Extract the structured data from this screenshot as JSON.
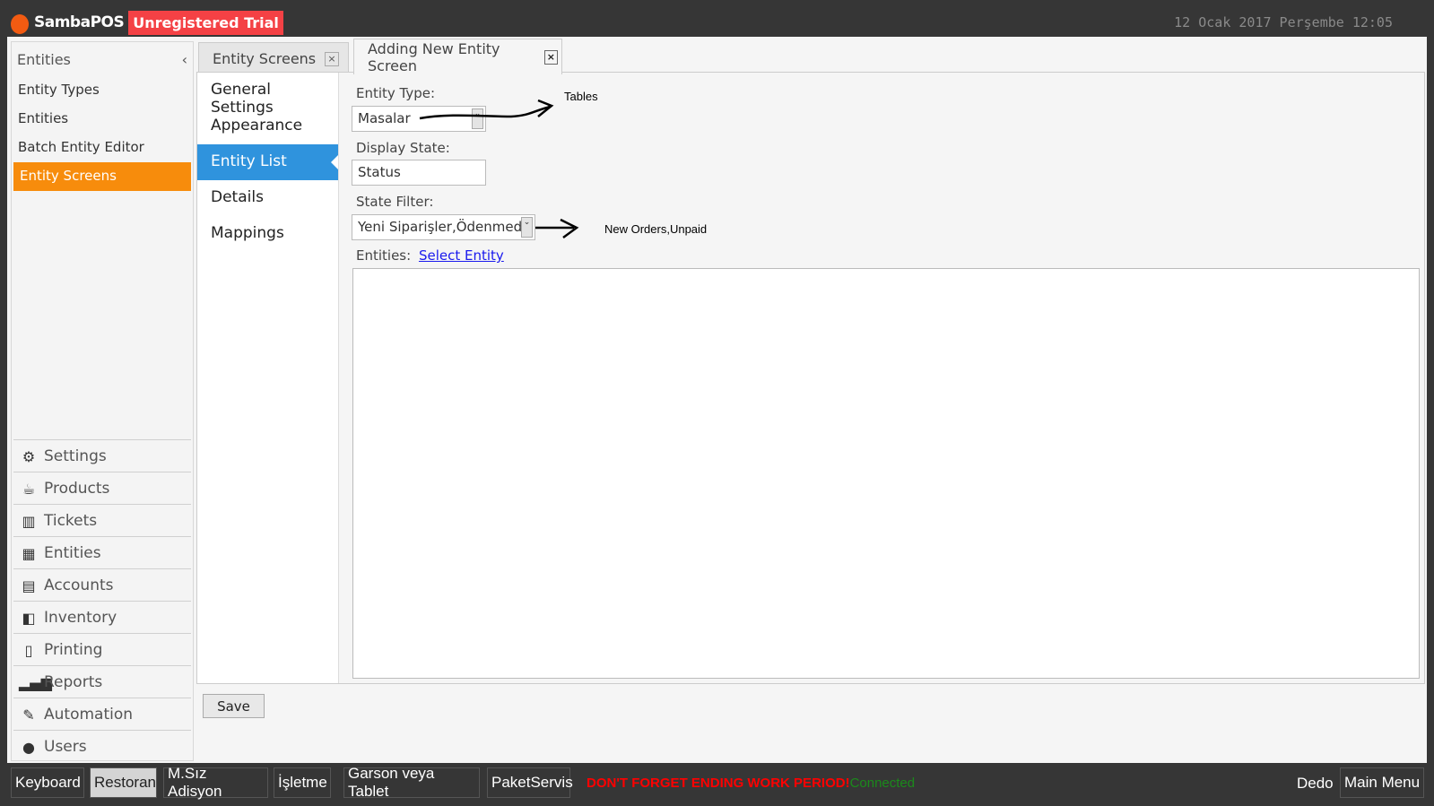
{
  "header": {
    "brand": "SambaPOS",
    "trial": "Unregistered Trial",
    "datetime": "12 Ocak 2017 Perşembe 12:05"
  },
  "leftnav": {
    "title": "Entities",
    "collapse": "‹",
    "items": [
      {
        "label": "Entity Types"
      },
      {
        "label": "Entities"
      },
      {
        "label": "Batch Entity Editor"
      },
      {
        "label": "Entity Screens",
        "active": true
      }
    ],
    "modules": [
      {
        "label": "Settings",
        "icon": "⚙"
      },
      {
        "label": "Products",
        "icon": "☕"
      },
      {
        "label": "Tickets",
        "icon": "▥"
      },
      {
        "label": "Entities",
        "icon": "▦"
      },
      {
        "label": "Accounts",
        "icon": "▤"
      },
      {
        "label": "Inventory",
        "icon": "◧"
      },
      {
        "label": "Printing",
        "icon": "▯"
      },
      {
        "label": "Reports",
        "icon": "▂▄▆"
      },
      {
        "label": "Automation",
        "icon": "✎"
      },
      {
        "label": "Users",
        "icon": "●"
      }
    ]
  },
  "tabs": [
    {
      "label": "Entity Screens",
      "close": "×"
    },
    {
      "label": "Adding New Entity Screen",
      "close": "×",
      "active": true
    }
  ],
  "subnav": [
    "General Settings",
    "Appearance",
    "Entity List",
    "Details",
    "Mappings"
  ],
  "form": {
    "entity_type_label": "Entity Type:",
    "entity_type_value": "Masalar",
    "display_state_label": "Display State:",
    "display_state_value": "Status",
    "state_filter_label": "State Filter:",
    "state_filter_value": "Yeni Siparişler,Ödenmedi",
    "entities_label": "Entities:",
    "select_entity": "Select Entity"
  },
  "annotations": {
    "tables": "Tables",
    "new_orders": "New Orders,Unpaid"
  },
  "save": "Save",
  "bottombar": {
    "buttons": [
      "Keyboard",
      "Restoran",
      "M.Sız Adisyon",
      "İşletme",
      "Garson veya Tablet",
      "PaketServis"
    ],
    "selected": "Restoran",
    "warning": "DON'T FORGET ENDING WORK PERIOD!",
    "status": "Connected",
    "user": "Dedo",
    "main_menu": "Main Menu"
  }
}
